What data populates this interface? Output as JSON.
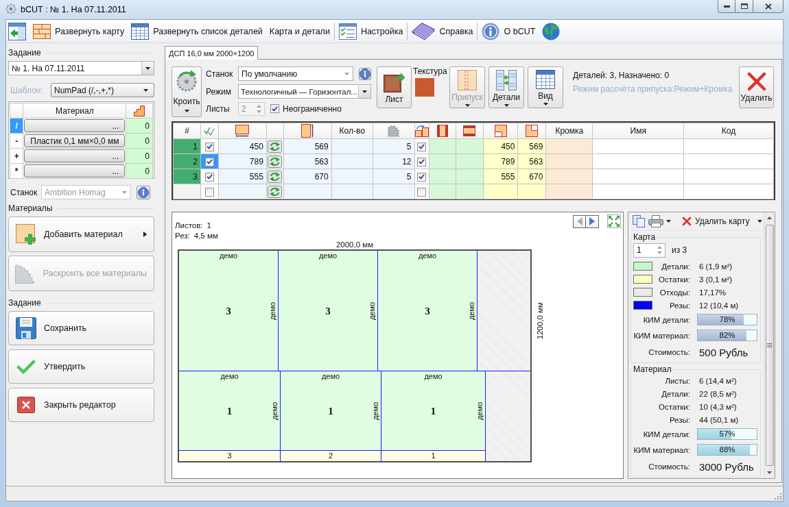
{
  "window": {
    "title": "bCUT : № 1. На 07.11.2011"
  },
  "toolbar": {
    "groups": [
      [
        {
          "kind": "icon"
        },
        {
          "kind": "labeled",
          "label": "Развернуть карту"
        },
        {
          "kind": "labeled",
          "label": "Развернуть список деталей"
        },
        {
          "kind": "text",
          "label": "Карта и детали"
        }
      ],
      [
        {
          "kind": "labeled",
          "label": "Настройка"
        }
      ],
      [
        {
          "kind": "labeled",
          "label": "Справка"
        }
      ],
      [
        {
          "kind": "labeled",
          "label": "О bCUT"
        },
        {
          "kind": "icon"
        }
      ]
    ]
  },
  "task_panel": {
    "heading": "Задание",
    "task": {
      "value": "№ 1. На 07.11.2011"
    },
    "template": {
      "label": "Шаблон:",
      "value": "NumPad (/,-,+,*)"
    },
    "material_table": {
      "column": "Материал",
      "rows": [
        {
          "key": "/",
          "material": "...",
          "count": "0",
          "selected": true
        },
        {
          "key": "-",
          "material": "Пластик 0,1 мм×0,0 мм",
          "count": "0",
          "selected": false
        },
        {
          "key": "+",
          "material": "...",
          "count": "0",
          "selected": false
        },
        {
          "key": "*",
          "material": "...",
          "count": "0",
          "selected": false
        }
      ]
    },
    "machine": {
      "label": "Станок",
      "value": "Ambition Homag",
      "disabled": true
    },
    "materials_heading": "Материалы",
    "material_actions": [
      {
        "label": "Добавить материал",
        "disabled": false,
        "submenu": true
      },
      {
        "label": "Раскроить все материалы",
        "disabled": true,
        "submenu": false
      }
    ],
    "task_heading": "Задание",
    "task_actions": [
      {
        "label": "Сохранить"
      },
      {
        "label": "Утвердить"
      },
      {
        "label": "Закрыть редактор"
      }
    ]
  },
  "sheet_tabs": [
    {
      "label": "ДСП 16,0 мм 2000×1200",
      "selected": true
    }
  ],
  "cutting_toolbar": {
    "cut_button": {
      "label": "Кроить"
    },
    "machine": {
      "label": "Станок",
      "value": "По умолчанию"
    },
    "mode": {
      "label": "Режим",
      "value": "Технологичный — Горизонтал..."
    },
    "sheets": {
      "label": "Листы",
      "value": "2",
      "disabled": true
    },
    "unlimited": {
      "label": "Неограниченно",
      "checked": true
    },
    "sheet_button": {
      "label": "Лист"
    },
    "texture": {
      "label": "Текстура"
    },
    "tool_buttons": [
      {
        "label": "Припуск",
        "disabled": true
      },
      {
        "label": "Детали",
        "disabled": false
      },
      {
        "label": "Вид",
        "disabled": false
      }
    ],
    "summary": "Деталей: 3, Назначено: 0",
    "allowance_mode": "Режим рассчёта припуска:Режим+Кромка",
    "delete_button": {
      "label": "Удалить"
    }
  },
  "parts_table": {
    "columns": [
      {
        "label": "#",
        "kind": "number"
      },
      {
        "kind": "check",
        "icon": true
      },
      {
        "kind": "text",
        "icon": true,
        "color": "#eef5fd"
      },
      {
        "kind": "swap",
        "icon": false,
        "color": "#eef5fd"
      },
      {
        "kind": "text",
        "icon": true,
        "color": "#eef5fd"
      },
      {
        "kind": "text",
        "label": "Кол-во",
        "color": "#eef5fd"
      },
      {
        "kind": "text",
        "icon": true,
        "color": "#eef5fd"
      },
      {
        "kind": "check",
        "icon": true
      },
      {
        "kind": "text",
        "icon": true,
        "color": "#d6f8d6"
      },
      {
        "kind": "text",
        "icon": true,
        "color": "#d6f8d6"
      },
      {
        "kind": "text",
        "icon": true,
        "color": "#ffffc8"
      },
      {
        "kind": "text",
        "icon": true,
        "color": "#ffffc8"
      },
      {
        "kind": "text",
        "label": "Кромка",
        "color": "#fdead6"
      },
      {
        "kind": "text",
        "label": "Имя"
      },
      {
        "kind": "text",
        "label": "Код"
      }
    ],
    "rows": [
      {
        "kind": "part",
        "number": "1",
        "column_2": {
          "checked": true,
          "selected": false
        },
        "column_3": "450",
        "column_5": "569",
        "column_7": "5",
        "column_8": {
          "checked": true,
          "selected": false
        },
        "column_11": "450",
        "column_12": "569"
      },
      {
        "kind": "part",
        "number": "2",
        "column_2": {
          "checked": true,
          "selected": true
        },
        "column_3": "789",
        "column_5": "563",
        "column_7": "12",
        "column_8": {
          "checked": true,
          "selected": false
        },
        "column_11": "789",
        "column_12": "563"
      },
      {
        "kind": "part",
        "number": "3",
        "column_2": {
          "checked": true,
          "selected": false
        },
        "column_3": "555",
        "column_5": "670",
        "column_7": "5",
        "column_8": {
          "checked": true,
          "selected": false
        },
        "column_11": "555",
        "column_12": "670"
      },
      {
        "kind": "new",
        "column_2": {
          "checked": false,
          "selected": false
        },
        "column_8": {
          "checked": false,
          "selected": false
        }
      }
    ]
  },
  "cut_map": {
    "info": [
      {
        "label": "Листов:",
        "value": "1"
      },
      {
        "label": "Рез:",
        "value": "4,5 мм"
      }
    ],
    "nav": [
      {
        "disabled": true
      },
      {
        "disabled": false
      }
    ],
    "width_label": "2000,0 мм",
    "height_label": "1200,0 мм",
    "strips": [
      {
        "pieces": [
          {
            "label": "демо",
            "number": "3",
            "side_label": "демо"
          },
          {
            "label": "демо",
            "number": "3",
            "side_label": "демо"
          },
          {
            "label": "демо",
            "number": "3",
            "side_label": "демо"
          }
        ]
      },
      {
        "pieces": [
          {
            "label": "демо",
            "number": "1",
            "side_label": "демо",
            "remnant": "3"
          },
          {
            "label": "демо",
            "number": "1",
            "side_label": "демо",
            "remnant": "2"
          },
          {
            "label": "демо",
            "number": "1",
            "side_label": "демо",
            "remnant": "1"
          }
        ]
      }
    ]
  },
  "map_toolbar": {
    "delete_button": {
      "label": "Удалить карту"
    }
  },
  "map_stats": {
    "title": "Карта",
    "page": {
      "value": "1",
      "total": "из 3"
    },
    "legend": [
      {
        "label": "Детали:",
        "value": "6 (1,9 м²)",
        "color": "#c8f7c8"
      },
      {
        "label": "Остатки:",
        "value": "3 (0,1 м²)",
        "color": "#ffffc0"
      },
      {
        "label": "Отходы:",
        "value": "17,17%",
        "color": "#eaeaea"
      },
      {
        "label": "Резы:",
        "value": "12 (10,4 м)",
        "color": "#0000ff"
      }
    ],
    "bars": [
      {
        "label": "КИМ детали:",
        "level": 0.78,
        "reading": "78%"
      },
      {
        "label": "КИМ материал:",
        "level": 0.82,
        "reading": "82%"
      }
    ],
    "cost": {
      "label": "Стоимость:",
      "value": "500 Рубль"
    }
  },
  "material_stats": {
    "title": "Материал",
    "rows": [
      {
        "label": "Листы:",
        "value": "6 (14,4 м²)"
      },
      {
        "label": "Детали:",
        "value": "22 (8,5 м²)"
      },
      {
        "label": "Остатки:",
        "value": "10 (4,3 м²)"
      },
      {
        "label": "Резы:",
        "value": "44 (50,1 м)"
      }
    ],
    "bars": [
      {
        "label": "КИМ детали:",
        "level": 0.57,
        "reading": "57%"
      },
      {
        "label": "КИМ материал:",
        "level": 0.88,
        "reading": "88%"
      }
    ],
    "cost": {
      "label": "Стоимость:",
      "value": "3000 Рубль"
    }
  }
}
